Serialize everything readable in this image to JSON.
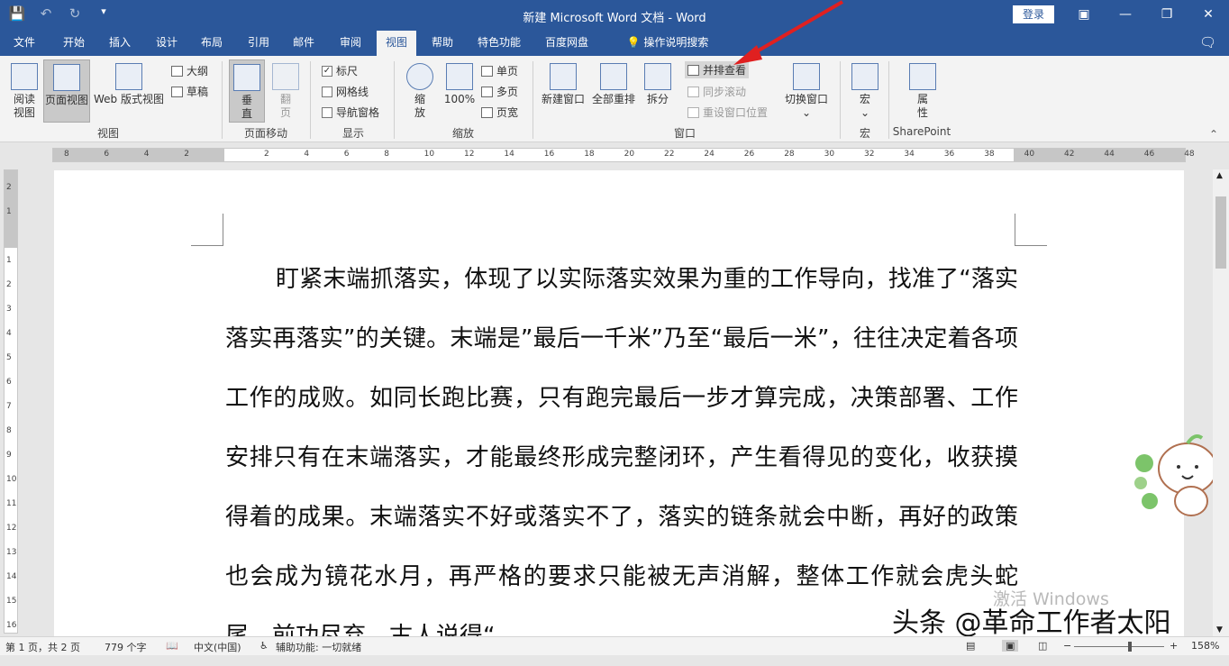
{
  "qat": {
    "save_icon": "save-icon",
    "undo_icon": "undo-icon",
    "redo_icon": "redo-icon",
    "customize_icon": "customize-icon"
  },
  "title": "新建 Microsoft Word 文档 - Word",
  "login_label": "登录",
  "window": {
    "ribbon_display": "▣",
    "minimize": "—",
    "restore": "❐",
    "close": "✕"
  },
  "tabs": [
    "文件",
    "开始",
    "插入",
    "设计",
    "布局",
    "引用",
    "邮件",
    "审阅",
    "视图",
    "帮助",
    "特色功能",
    "百度网盘"
  ],
  "active_tab": "视图",
  "tell_me": "操作说明搜索",
  "ribbon": {
    "views": {
      "read": "阅读\n视图",
      "print_layout": "页面视图",
      "web": "Web 版式视图",
      "outline": "大纲",
      "draft": "草稿",
      "group": "视图"
    },
    "page_move": {
      "vertical": "垂直",
      "side": "翻页",
      "group": "页面移动"
    },
    "show": {
      "ruler": "标尺",
      "gridlines": "网格线",
      "nav_pane": "导航窗格",
      "group": "显示",
      "ruler_checked": true,
      "gridlines_checked": false,
      "nav_checked": false
    },
    "zoom": {
      "zoom": "缩放",
      "hundred": "100%",
      "one_page": "单页",
      "multi_page": "多页",
      "page_width": "页宽",
      "group": "缩放"
    },
    "window": {
      "new_window": "新建窗口",
      "arrange_all": "全部重排",
      "split": "拆分",
      "side_by_side": "并排查看",
      "sync_scroll": "同步滚动",
      "reset_pos": "重设窗口位置",
      "switch": "切换窗口",
      "group": "窗口"
    },
    "macros": {
      "macros": "宏",
      "group": "宏"
    },
    "sharepoint": {
      "properties": "属性",
      "group": "SharePoint"
    }
  },
  "ruler": {
    "labels": [
      "8",
      "6",
      "4",
      "2",
      "",
      "2",
      "4",
      "6",
      "8",
      "10",
      "12",
      "14",
      "16",
      "18",
      "20",
      "22",
      "24",
      "26",
      "28",
      "30",
      "32",
      "34",
      "36",
      "38",
      "40",
      "42",
      "44",
      "46",
      "48"
    ]
  },
  "vruler": {
    "labels": [
      "2",
      "1",
      "",
      "1",
      "2",
      "3",
      "4",
      "5",
      "6",
      "7",
      "8",
      "9",
      "10",
      "11",
      "12",
      "13",
      "14",
      "15",
      "16"
    ]
  },
  "document": {
    "paragraph": "盯紧末端抓落实，体现了以实际落实效果为重的工作导向，找准了“落实落实再落实”的关键。末端是”最后一千米”乃至“最后一米”，往往决定着各项工作的成败。如同长跑比赛，只有跑完最后一步才算完成，决策部署、工作安排只有在末端落实，才能最终形成完整闭环，产生看得见的变化，收获摸得着的成果。末端落实不好或落实不了，落实的链条就会中断，再好的政策也会成为镜花水月，再严格的要求只能被无声消解，整体工作就会虎头蛇尾、前功尽弃。古人说得“"
  },
  "watermark": "激活 Windows",
  "overlay_text": "头条 @革命工作者太阳",
  "status": {
    "page": "第 1 页，共 2 页",
    "words": "779 个字",
    "lang": "中文(中国)",
    "accessibility": "辅助功能: 一切就绪",
    "zoom": "158%"
  },
  "colors": {
    "brand": "#2b579a",
    "annotation_arrow": "#e02020"
  }
}
